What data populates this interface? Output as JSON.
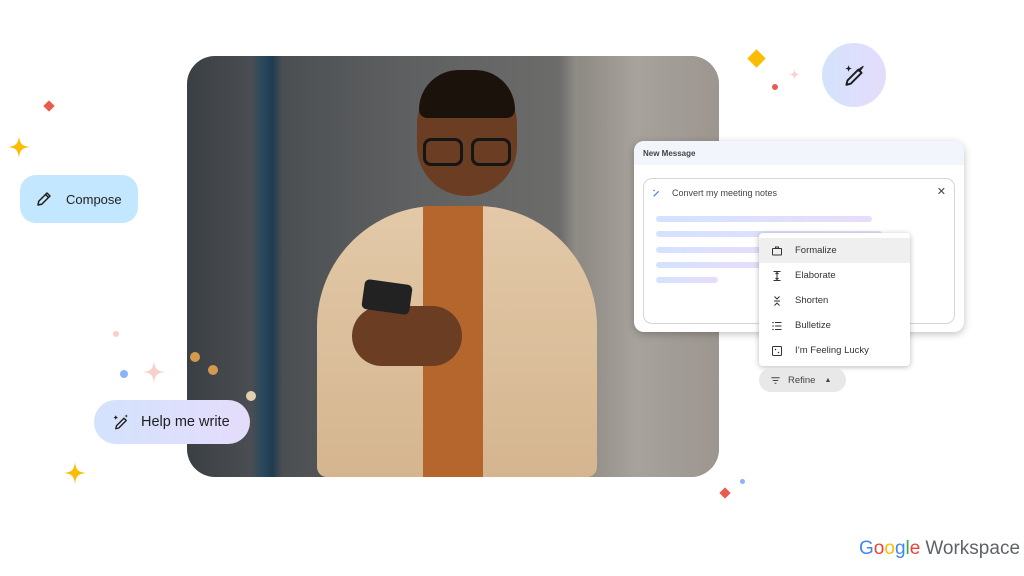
{
  "photo": {
    "description": "Smiling man in beige trench coat and glasses using a smartphone"
  },
  "compose_chip": {
    "label": "Compose",
    "icon": "pencil-icon",
    "color": "#c2e7ff"
  },
  "help_me_write_chip": {
    "label": "Help me write",
    "icon": "magic-pen-icon"
  },
  "magic_button": {
    "icon": "magic-pen-icon"
  },
  "new_message": {
    "title": "New Message",
    "prompt": "Convert my meeting notes",
    "close_icon": "close-icon"
  },
  "refine_menu": {
    "items": [
      {
        "label": "Formalize",
        "icon": "briefcase-icon",
        "active": true
      },
      {
        "label": "Elaborate",
        "icon": "expand-vertical-icon"
      },
      {
        "label": "Shorten",
        "icon": "collapse-vertical-icon"
      },
      {
        "label": "Bulletize",
        "icon": "bulleted-list-icon"
      },
      {
        "label": "I’m Feeling Lucky",
        "icon": "dice-icon"
      }
    ]
  },
  "refine_button": {
    "label": "Refine",
    "icon": "filter-icon",
    "caret": "▲"
  },
  "logo": {
    "google": [
      "G",
      "o",
      "o",
      "g",
      "l",
      "e"
    ],
    "google_colors": [
      "#4285f4",
      "#ea4335",
      "#fbbc04",
      "#4285f4",
      "#34a853",
      "#ea4335"
    ],
    "product": "Workspace"
  },
  "decor_colors": {
    "yellow": "#fbbc04",
    "red": "#ea5a4f",
    "pink": "#f8cfcd",
    "blue": "#8ab4f8"
  }
}
